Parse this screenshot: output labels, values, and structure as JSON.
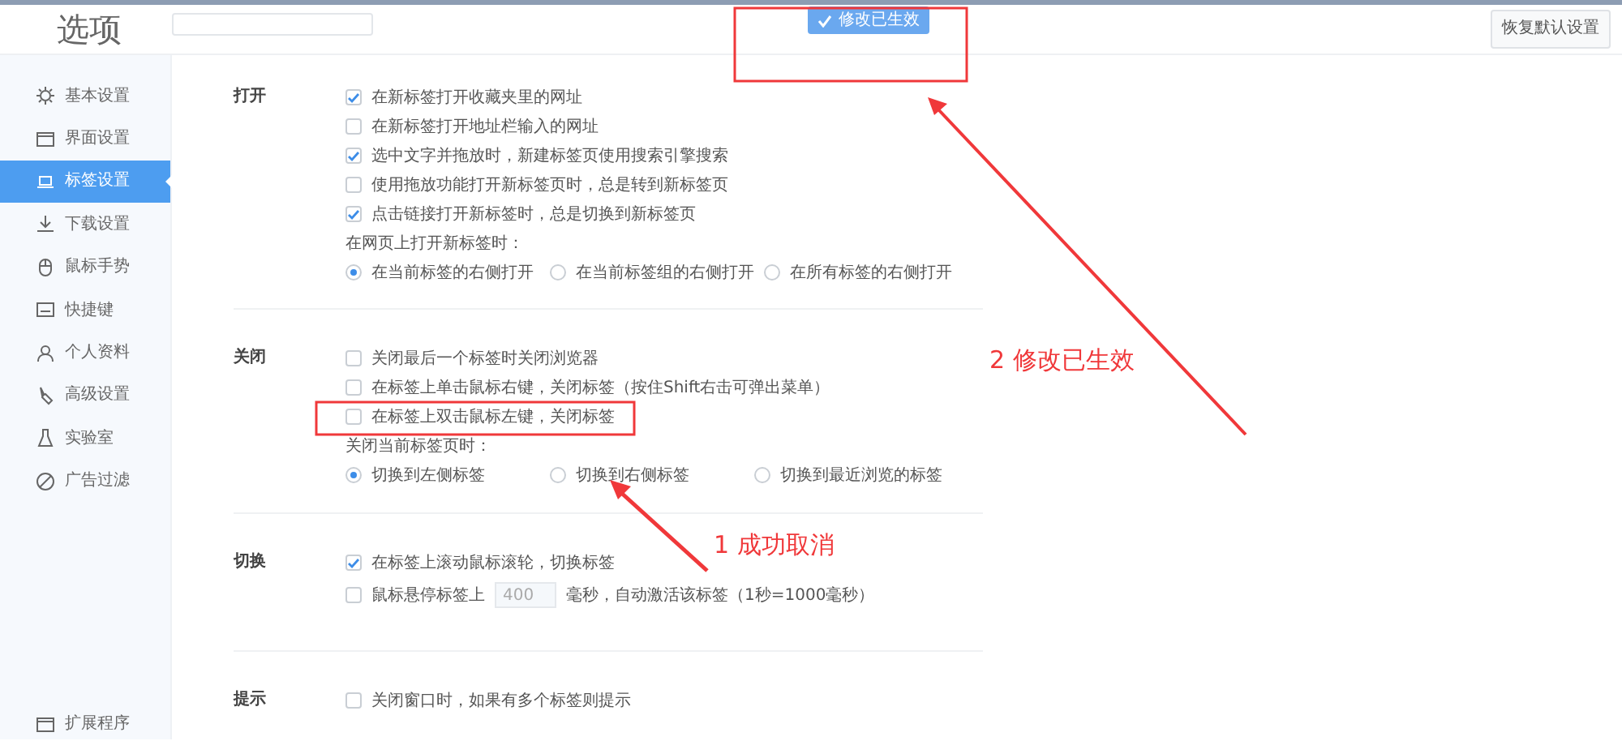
{
  "window": {
    "title": "选项"
  },
  "toast": {
    "text": "修改已生效"
  },
  "restore_button": "恢复默认设置",
  "sidebar": {
    "items": [
      {
        "label": "基本设置",
        "selected": false
      },
      {
        "label": "界面设置",
        "selected": false
      },
      {
        "label": "标签设置",
        "selected": true
      },
      {
        "label": "下载设置",
        "selected": false
      },
      {
        "label": "鼠标手势",
        "selected": false
      },
      {
        "label": "快捷键",
        "selected": false
      },
      {
        "label": "个人资料",
        "selected": false
      },
      {
        "label": "高级设置",
        "selected": false
      },
      {
        "label": "实验室",
        "selected": false
      },
      {
        "label": "广告过滤",
        "selected": false
      }
    ],
    "bottom_item": "扩展程序"
  },
  "sections": [
    {
      "title": "打开",
      "options": [
        {
          "kind": "checkbox",
          "label": "在新标签打开收藏夹里的网址",
          "checked": true
        },
        {
          "kind": "checkbox",
          "label": "在新标签打开地址栏输入的网址",
          "checked": false
        },
        {
          "kind": "checkbox",
          "label": "选中文字并拖放时，新建标签页使用搜索引擎搜索",
          "checked": true
        },
        {
          "kind": "checkbox",
          "label": "使用拖放功能打开新标签页时，总是转到新标签页",
          "checked": false
        },
        {
          "kind": "checkbox",
          "label": "点击链接打开新标签时，总是切换到新标签页",
          "checked": true
        }
      ],
      "radio_prompt": "在网页上打开新标签时：",
      "radios": [
        {
          "label": "在当前标签的右侧打开",
          "selected": true
        },
        {
          "label": "在当前标签组的右侧打开",
          "selected": false
        },
        {
          "label": "在所有标签的右侧打开",
          "selected": false
        }
      ]
    },
    {
      "title": "关闭",
      "options": [
        {
          "kind": "checkbox",
          "label": "关闭最后一个标签时关闭浏览器",
          "checked": false
        },
        {
          "kind": "checkbox",
          "label": "在标签上单击鼠标右键，关闭标签（按住Shift右击可弹出菜单）",
          "checked": false
        },
        {
          "kind": "checkbox",
          "label": "在标签上双击鼠标左键，关闭标签",
          "checked": false
        }
      ],
      "radio_prompt": "关闭当前标签页时：",
      "radios": [
        {
          "label": "切换到左侧标签",
          "selected": true
        },
        {
          "label": "切换到右侧标签",
          "selected": false
        },
        {
          "label": "切换到最近浏览的标签",
          "selected": false
        }
      ]
    },
    {
      "title": "切换",
      "options": [
        {
          "kind": "checkbox",
          "label": "在标签上滚动鼠标滚轮，切换标签",
          "checked": true
        },
        {
          "kind": "delay",
          "label": "鼠标悬停标签上",
          "value": "400",
          "suffix": "毫秒，自动激活该标签（1秒=1000毫秒）",
          "checked": false
        }
      ]
    },
    {
      "title": "提示",
      "options": [
        {
          "kind": "checkbox",
          "label": "关闭窗口时，如果有多个标签则提示",
          "checked": false
        }
      ]
    }
  ],
  "annotations": [
    {
      "text": "1  成功取消"
    },
    {
      "text": "2 修改已生效"
    }
  ]
}
